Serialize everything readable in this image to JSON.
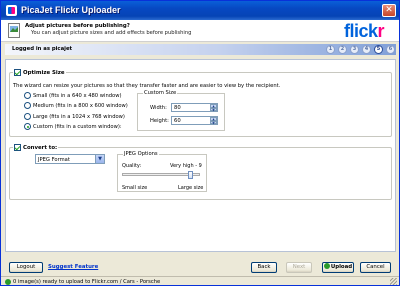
{
  "window": {
    "title": "PicaJet Flickr Uploader",
    "close_glyph": "✕"
  },
  "header": {
    "title": "Adjust pictures before publishing?",
    "subtitle": "You can adjust picture sizes and add effects before publishing",
    "logo_blue": "flick",
    "logo_pink": "r"
  },
  "stepbar": {
    "label": "Logged in as picajet",
    "steps": [
      "1",
      "2",
      "3",
      "4",
      "5",
      "6"
    ],
    "active_step": "5"
  },
  "optimize": {
    "label": "Optimize Size",
    "checked": true,
    "description": "The wizard can resize your pictures so that they transfer faster and are easier to view by the recipient.",
    "options": [
      "Small (fits in a 640 x 480 window)",
      "Medium (fits in a 800 x 600 window)",
      "Large (fits in a 1024 x 768 window)",
      "Custom (fits in a custom window):"
    ],
    "selected_option": "Custom (fits in a custom window):",
    "custom_size": {
      "legend": "Custom Size",
      "width_label": "Width:",
      "width_value": "80",
      "height_label": "Height:",
      "height_value": "60"
    }
  },
  "convert": {
    "label": "Convert to:",
    "checked": true,
    "format_value": "JPEG Format",
    "jpeg_options": {
      "legend": "JPEG Options",
      "quality_label": "Quality:",
      "quality_value": "Very high - 9",
      "quality_level": 0.9,
      "min_label": "Small size",
      "max_label": "Large size"
    }
  },
  "footer": {
    "logout_label": "Logout",
    "suggest_label": "Suggest Feature",
    "back_label": "Back",
    "next_label": "Next",
    "upload_label": "Upload",
    "cancel_label": "Cancel"
  },
  "status": {
    "text": "0 image(s) ready to upload to Flickr.com / Cars - Porsche"
  },
  "colors": {
    "flickr_blue": "#0063dc",
    "flickr_pink": "#ff0084",
    "titlebar": "#0748c2"
  }
}
